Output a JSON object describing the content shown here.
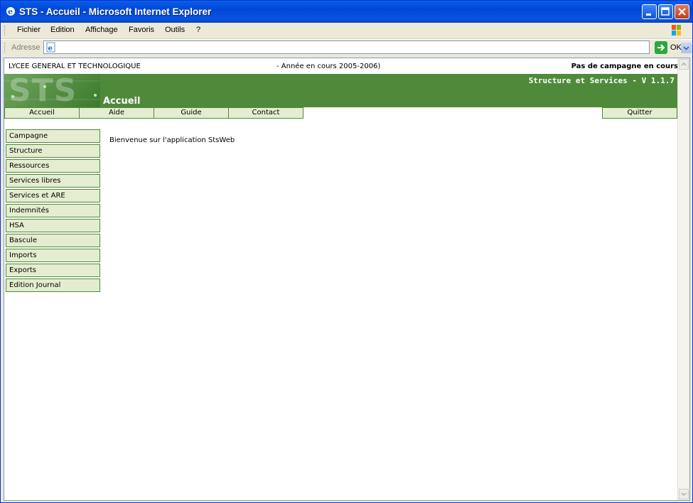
{
  "window": {
    "title": "STS - Accueil - Microsoft Internet Explorer"
  },
  "menubar": {
    "items": [
      "Fichier",
      "Edition",
      "Affichage",
      "Favoris",
      "Outils",
      "?"
    ]
  },
  "addressbar": {
    "label": "Adresse",
    "value": "",
    "go_label": "OK"
  },
  "page": {
    "school": "LYCEE GENERAL ET TECHNOLOGIQUE",
    "year": "- Année en cours 2005-2006)",
    "campaign_status": "Pas de campagne en cours",
    "logo_text": "STS",
    "app_version": "Structure et Services - V 1.1.7",
    "section_title": "Accueil",
    "nav_tabs": [
      "Accueil",
      "Aide",
      "Guide",
      "Contact"
    ],
    "quit_label": "Quitter",
    "side_menu": [
      "Campagne",
      "Structure",
      "Ressources",
      "Services libres",
      "Services et ARE",
      "Indemnités",
      "HSA",
      "Bascule",
      "Imports",
      "Exports",
      "Edition Journal"
    ],
    "welcome_text": "Bienvenue sur l'application StsWeb"
  },
  "colors": {
    "banner_green": "#4f8a3b",
    "menu_bg": "#e4edcf",
    "titlebar_blue": "#0047d8"
  }
}
